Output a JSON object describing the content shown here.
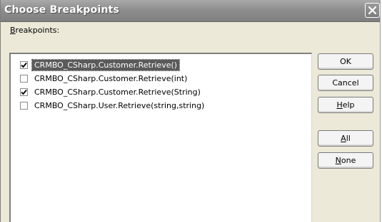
{
  "window": {
    "title": "Choose Breakpoints"
  },
  "list": {
    "label_accel": "B",
    "label_rest": "reakpoints:",
    "items": [
      {
        "label": "CRMBO_CSharp.Customer.Retrieve()",
        "checked": true,
        "selected": true
      },
      {
        "label": "CRMBO_CSharp.Customer.Retrieve(int)",
        "checked": false,
        "selected": false
      },
      {
        "label": "CRMBO_CSharp.Customer.Retrieve(String)",
        "checked": true,
        "selected": false
      },
      {
        "label": "CRMBO_CSharp.User.Retrieve(string,string)",
        "checked": false,
        "selected": false
      }
    ]
  },
  "buttons": {
    "ok": "OK",
    "cancel": "Cancel",
    "help_accel": "H",
    "help_rest": "elp",
    "all_accel": "A",
    "all_rest": "ll",
    "none_accel": "N",
    "none_rest": "one"
  },
  "icons": {
    "close": "close-icon",
    "check": "check-icon"
  },
  "colors": {
    "dialog_bg": "#ece9d8",
    "titlebar": "#8e8e8e",
    "selection": "#5a5a5a"
  }
}
